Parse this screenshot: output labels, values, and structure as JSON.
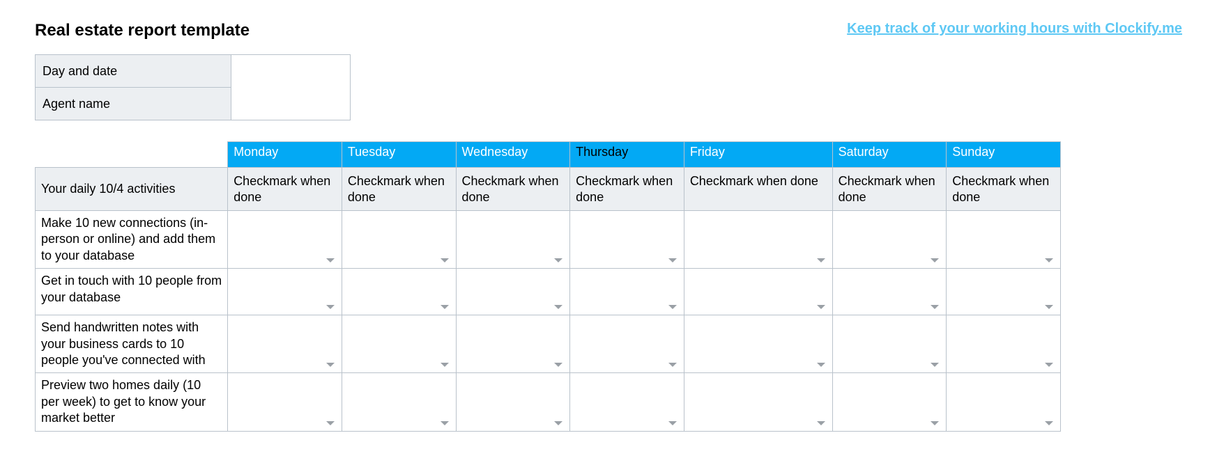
{
  "header": {
    "title": "Real estate report template",
    "promo": "Keep track of your working hours with Clockify.me"
  },
  "meta": {
    "day_date_label": "Day and date",
    "day_date_value": "",
    "agent_name_label": "Agent name",
    "agent_name_value": ""
  },
  "days": [
    "Monday",
    "Tuesday",
    "Wednesday",
    "Thursday",
    "Friday",
    "Saturday",
    "Sunday"
  ],
  "subheader": {
    "activities_label": "Your daily 10/4 activities",
    "checkmark_label": "Checkmark when done"
  },
  "activities": [
    "Make 10 new connections (in-person or online) and add them to your database",
    "Get in touch with 10 people from your database",
    "Send handwritten notes with your business cards to 10 people you've connected with",
    "Preview two homes daily (10 per week) to get to know your market better"
  ],
  "colors": {
    "day_header_bg": "#03a9f4",
    "link_color": "#5ec8f4",
    "cell_shade": "#eceff2",
    "border": "#b9c2cb"
  }
}
